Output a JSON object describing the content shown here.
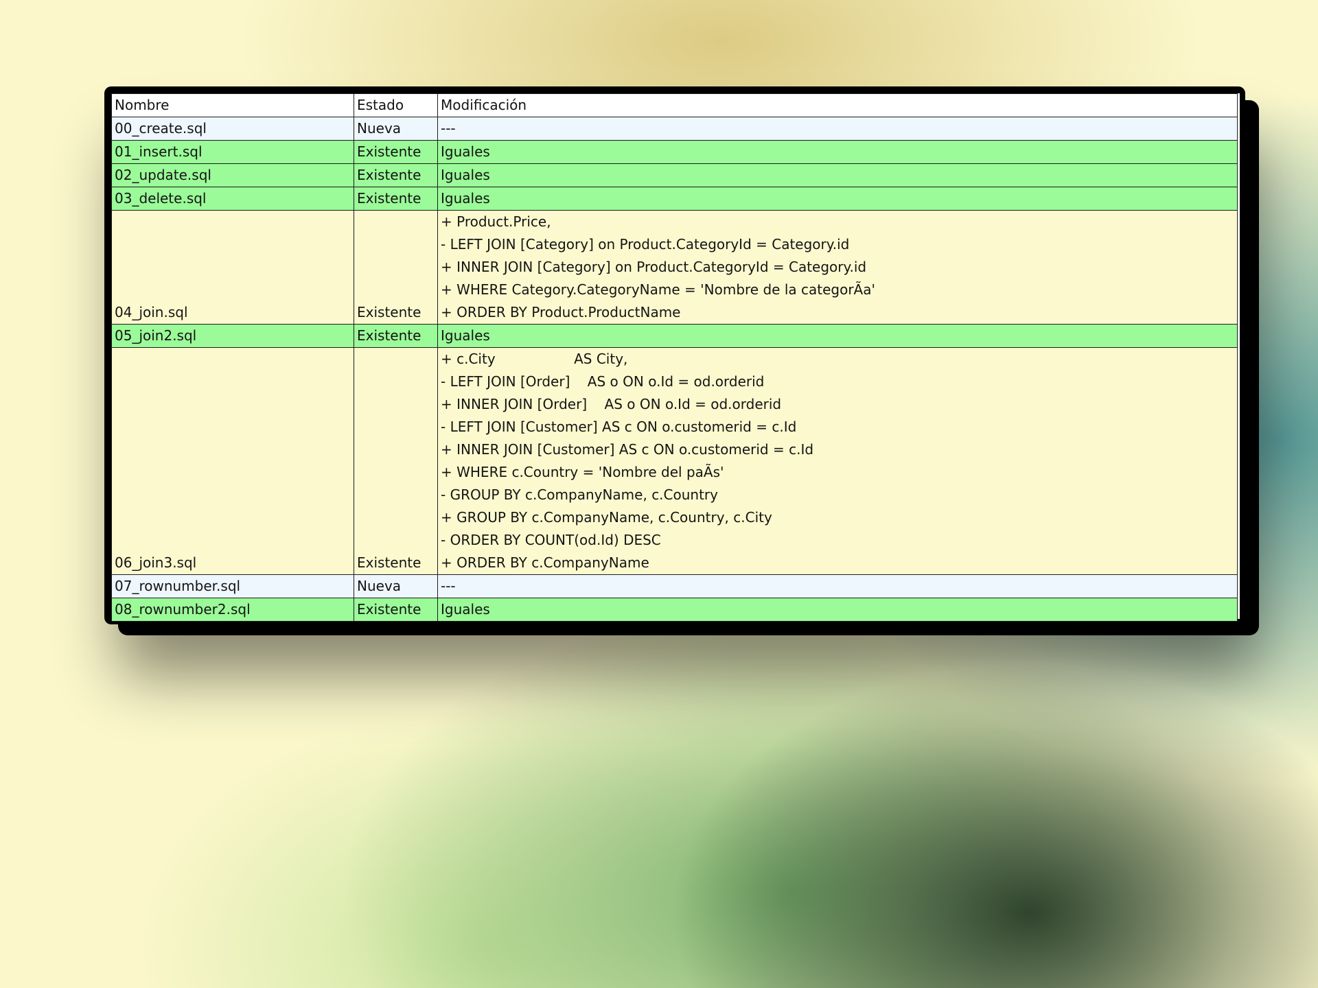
{
  "table": {
    "headers": [
      "Nombre",
      "Estado",
      "Modificación"
    ],
    "rows": [
      {
        "nombre": "00_create.sql",
        "estado": "Nueva",
        "modificacion": [
          "---"
        ]
      },
      {
        "nombre": "01_insert.sql",
        "estado": "Existente",
        "modificacion": [
          "Iguales"
        ]
      },
      {
        "nombre": "02_update.sql",
        "estado": "Existente",
        "modificacion": [
          "Iguales"
        ]
      },
      {
        "nombre": "03_delete.sql",
        "estado": "Existente",
        "modificacion": [
          "Iguales"
        ]
      },
      {
        "nombre": "04_join.sql",
        "estado": "Existente",
        "modificacion": [
          "+ Product.Price,",
          "- LEFT JOIN [Category] on Product.CategoryId = Category.id",
          "+ INNER JOIN [Category] on Product.CategoryId = Category.id",
          "+ WHERE Category.CategoryName = 'Nombre de la categorÃ­a'",
          "+ ORDER BY Product.ProductName"
        ]
      },
      {
        "nombre": "05_join2.sql",
        "estado": "Existente",
        "modificacion": [
          "Iguales"
        ]
      },
      {
        "nombre": "06_join3.sql",
        "estado": "Existente",
        "modificacion": [
          "+ c.City                  AS City,",
          "- LEFT JOIN [Order]    AS o ON o.Id = od.orderid",
          "+ INNER JOIN [Order]    AS o ON o.Id = od.orderid",
          "- LEFT JOIN [Customer] AS c ON o.customerid = c.Id",
          "+ INNER JOIN [Customer] AS c ON o.customerid = c.Id",
          "+ WHERE c.Country = 'Nombre del paÃ­s'",
          "- GROUP BY c.CompanyName, c.Country",
          "+ GROUP BY c.CompanyName, c.Country, c.City",
          "- ORDER BY COUNT(od.Id) DESC",
          "+ ORDER BY c.CompanyName"
        ]
      },
      {
        "nombre": "07_rownumber.sql",
        "estado": "Nueva",
        "modificacion": [
          "---"
        ]
      },
      {
        "nombre": "08_rownumber2.sql",
        "estado": "Existente",
        "modificacion": [
          "Iguales"
        ]
      }
    ]
  },
  "colors": {
    "nueva": "#eef6fe",
    "existente_iguales": "#9afb98",
    "modified": "#fdf9cf"
  }
}
